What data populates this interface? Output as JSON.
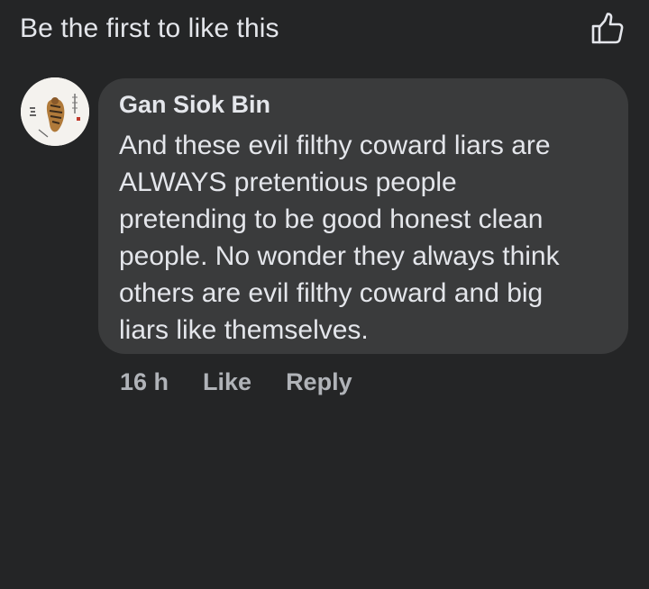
{
  "likes_summary": {
    "text": "Be the first to like this",
    "icon": "thumbs-up-icon"
  },
  "comment": {
    "avatar_icon": "profile-avatar-image",
    "author": "Gan Siok Bin",
    "text": "And these evil filthy coward liars  are\nALWAYS pretentious people\npretending to be good honest clean\npeople. No wonder they always think\nothers are evil filthy coward and big\nliars like themselves.",
    "time": "16 h",
    "like_label": "Like",
    "reply_label": "Reply"
  },
  "colors": {
    "background": "#242526",
    "bubble": "#3a3b3c",
    "primary_text": "#e4e6eb",
    "secondary_text": "#b0b3b8"
  }
}
